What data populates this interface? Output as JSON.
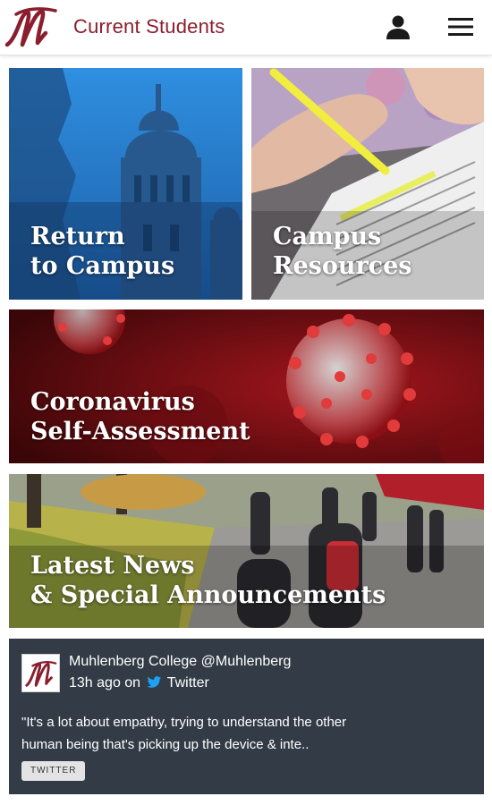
{
  "header": {
    "title": "Current Students",
    "logo_icon": "muhlenberg-m-logo",
    "user_icon": "user-icon",
    "menu_icon": "hamburger-menu-icon",
    "brand_color": "#8a1e2e"
  },
  "tiles": [
    {
      "lines": [
        "Return",
        "to Campus"
      ]
    },
    {
      "lines": [
        "Campus",
        "Resources"
      ]
    },
    {
      "lines": [
        "Coronavirus",
        "Self-Assessment"
      ]
    },
    {
      "lines": [
        "Latest News",
        "& Special Announcements"
      ]
    }
  ],
  "tweet": {
    "author": "Muhlenberg College @Muhlenberg",
    "time": "13h ago on",
    "source": "Twitter",
    "text_line1": "\"It's a lot about empathy, trying to understand the other",
    "text_line2": "human being that's picking up the device & inte..",
    "badge": "TWITTER",
    "card_color": "#333c46",
    "twitter_color": "#1da1f2"
  }
}
